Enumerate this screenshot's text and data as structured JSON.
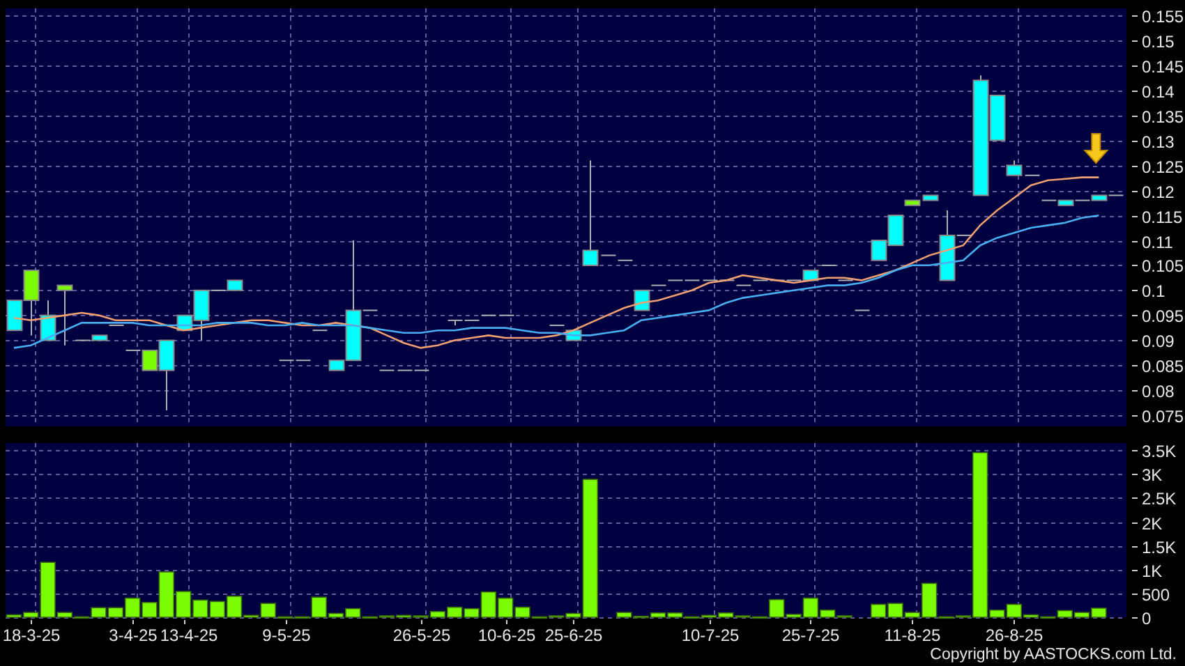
{
  "price_panel": {
    "chart_data": {
      "type": "candlestick",
      "grid": true,
      "categories": [
        null,
        null,
        null,
        null,
        null,
        null,
        null,
        null,
        null,
        null,
        null,
        null,
        null,
        null,
        null,
        null,
        null,
        null,
        null,
        null,
        null,
        null,
        null,
        null,
        null,
        null,
        null,
        null,
        null,
        null,
        null,
        null,
        null,
        null,
        null,
        null,
        null,
        null,
        null,
        null,
        null,
        null,
        null,
        null,
        null,
        null,
        null,
        null,
        null,
        null,
        null,
        null,
        null,
        null,
        null,
        null,
        null,
        null,
        null,
        null,
        null,
        null,
        null,
        null,
        null,
        null
      ],
      "yticks": [
        0.075,
        0.08,
        0.085,
        0.09,
        0.095,
        0.1,
        0.105,
        0.11,
        0.115,
        0.12,
        0.125,
        0.13,
        0.135,
        0.14,
        0.145,
        0.15,
        0.155
      ],
      "ylim": [
        0.0728,
        0.1564
      ],
      "ohlc": [
        [
          0.098,
          0.098,
          0.092,
          0.092
        ],
        [
          0.098,
          0.104,
          0.091,
          0.104
        ],
        [
          0.095,
          0.098,
          0.09,
          0.09
        ],
        [
          0.1,
          0.101,
          0.089,
          0.101
        ],
        [
          0.09,
          0.09,
          0.09,
          0.09
        ],
        [
          0.091,
          0.091,
          0.09,
          0.09
        ],
        [
          0.093,
          0.093,
          0.093,
          0.093
        ],
        [
          0.088,
          0.088,
          0.088,
          0.088
        ],
        [
          0.084,
          0.088,
          0.084,
          0.088
        ],
        [
          0.09,
          0.09,
          0.076,
          0.084
        ],
        [
          0.095,
          0.095,
          0.092,
          0.092
        ],
        [
          0.1,
          0.1,
          0.09,
          0.094
        ],
        [
          0.1,
          0.1,
          0.1,
          0.1
        ],
        [
          0.102,
          0.102,
          0.1,
          0.1
        ],
        null,
        null,
        [
          0.086,
          0.086,
          0.086,
          0.086
        ],
        [
          0.086,
          0.086,
          0.086,
          0.086
        ],
        [
          0.092,
          0.092,
          0.092,
          0.092
        ],
        [
          0.086,
          0.086,
          0.084,
          0.084
        ],
        [
          0.096,
          0.11,
          0.086,
          0.086
        ],
        [
          0.096,
          0.096,
          0.096,
          0.096
        ],
        [
          0.084,
          0.084,
          0.084,
          0.084
        ],
        [
          0.084,
          0.084,
          0.084,
          0.084
        ],
        [
          0.084,
          0.084,
          0.084,
          0.084
        ],
        null,
        [
          0.094,
          0.094,
          0.093,
          0.094
        ],
        [
          0.094,
          0.094,
          0.094,
          0.094
        ],
        [
          0.095,
          0.095,
          0.095,
          0.095
        ],
        [
          0.095,
          0.095,
          0.095,
          0.095
        ],
        null,
        null,
        [
          0.093,
          0.093,
          0.093,
          0.093
        ],
        [
          0.092,
          0.092,
          0.09,
          0.09
        ],
        [
          0.108,
          0.126,
          0.105,
          0.105
        ],
        [
          0.107,
          0.107,
          0.107,
          0.107
        ],
        [
          0.106,
          0.106,
          0.106,
          0.106
        ],
        [
          0.1,
          0.1,
          0.096,
          0.096
        ],
        [
          0.101,
          0.101,
          0.101,
          0.101
        ],
        [
          0.102,
          0.102,
          0.102,
          0.102
        ],
        [
          0.102,
          0.102,
          0.102,
          0.102
        ],
        [
          0.102,
          0.102,
          0.102,
          0.102
        ],
        [
          0.102,
          0.102,
          0.102,
          0.102
        ],
        [
          0.101,
          0.101,
          0.101,
          0.101
        ],
        [
          0.102,
          0.102,
          0.102,
          0.102
        ],
        [
          0.102,
          0.102,
          0.102,
          0.102
        ],
        [
          0.102,
          0.102,
          0.102,
          0.102
        ],
        [
          0.104,
          0.104,
          0.102,
          0.102
        ],
        [
          0.105,
          0.105,
          0.105,
          0.105
        ],
        [
          0.102,
          0.102,
          0.102,
          0.102
        ],
        [
          0.096,
          0.096,
          0.096,
          0.096
        ],
        [
          0.11,
          0.11,
          0.106,
          0.106
        ],
        [
          0.115,
          0.115,
          0.109,
          0.109
        ],
        [
          0.117,
          0.118,
          0.117,
          0.118
        ],
        [
          0.119,
          0.119,
          0.118,
          0.118
        ],
        [
          0.111,
          0.116,
          0.102,
          0.102
        ],
        [
          0.111,
          0.111,
          0.111,
          0.111
        ],
        [
          0.142,
          0.143,
          0.119,
          0.119
        ],
        [
          0.139,
          0.139,
          0.13,
          0.13
        ],
        [
          0.125,
          0.126,
          0.123,
          0.123
        ],
        [
          0.123,
          0.123,
          0.123,
          0.123
        ],
        [
          0.118,
          0.118,
          0.118,
          0.118
        ],
        [
          0.118,
          0.118,
          0.117,
          0.117
        ],
        [
          0.118,
          0.118,
          0.118,
          0.118
        ],
        [
          0.119,
          0.119,
          0.118,
          0.118
        ],
        [
          0.119,
          0.119,
          0.119,
          0.119
        ]
      ],
      "series": [
        {
          "type": "line",
          "color": "#f0a070",
          "values": [
            0.0945,
            0.094,
            0.0945,
            0.095,
            0.0955,
            0.095,
            0.094,
            0.094,
            0.094,
            0.093,
            0.092,
            0.0925,
            0.093,
            0.0935,
            0.094,
            0.094,
            0.0935,
            0.093,
            0.093,
            0.0935,
            0.093,
            0.0925,
            0.091,
            0.0895,
            0.0885,
            0.089,
            0.09,
            0.0905,
            0.091,
            0.0905,
            0.0905,
            0.0905,
            0.091,
            0.092,
            0.0935,
            0.095,
            0.0965,
            0.0975,
            0.098,
            0.099,
            0.1,
            0.1015,
            0.102,
            0.103,
            0.1025,
            0.102,
            0.1015,
            0.102,
            0.1025,
            0.1025,
            0.102,
            0.103,
            0.104,
            0.1055,
            0.107,
            0.108,
            0.109,
            0.113,
            0.116,
            0.1185,
            0.121,
            0.122,
            0.1223,
            0.1226,
            0.1226,
            null
          ]
        },
        {
          "type": "line",
          "color": "#48aef0",
          "values": [
            0.0885,
            0.089,
            0.0905,
            0.092,
            0.0935,
            0.0935,
            0.0935,
            0.0935,
            0.093,
            0.093,
            0.093,
            0.093,
            0.0935,
            0.0935,
            0.0935,
            0.093,
            0.093,
            0.0935,
            0.093,
            0.093,
            0.093,
            0.0925,
            0.092,
            0.0915,
            0.0915,
            0.092,
            0.092,
            0.0925,
            0.0925,
            0.0925,
            0.092,
            0.0915,
            0.0915,
            0.091,
            0.091,
            0.0915,
            0.092,
            0.094,
            0.0945,
            0.095,
            0.0955,
            0.096,
            0.0975,
            0.0985,
            0.099,
            0.0995,
            0.1,
            0.1005,
            0.101,
            0.101,
            0.1015,
            0.1025,
            0.104,
            0.105,
            0.105,
            0.1055,
            0.106,
            0.109,
            0.1105,
            0.1115,
            0.1125,
            0.113,
            0.1135,
            0.1145,
            0.115,
            null
          ]
        }
      ]
    }
  },
  "volume_panel": {
    "chart_data": {
      "type": "bar",
      "grid": true,
      "categories": [
        null,
        "18-3-25",
        null,
        null,
        null,
        null,
        null,
        "3-4-25",
        null,
        null,
        "13-4-25",
        null,
        null,
        null,
        null,
        null,
        "9-5-25",
        null,
        null,
        null,
        null,
        null,
        null,
        null,
        "26-5-25",
        null,
        null,
        null,
        null,
        "10-6-25",
        null,
        null,
        null,
        "25-6-25",
        null,
        null,
        null,
        null,
        null,
        null,
        null,
        "10-7-25",
        null,
        null,
        null,
        null,
        null,
        "25-7-25",
        null,
        null,
        null,
        null,
        null,
        "11-8-25",
        null,
        null,
        null,
        null,
        null,
        "26-8-25",
        null,
        null,
        null,
        null,
        null,
        null
      ],
      "ylim": [
        0,
        3650
      ],
      "yticks": [
        {
          "value": 0,
          "label": "0"
        },
        {
          "value": 500,
          "label": "500"
        },
        {
          "value": 1000,
          "label": "1K"
        },
        {
          "value": 1500,
          "label": "1.5K"
        },
        {
          "value": 2000,
          "label": "2K"
        },
        {
          "value": 2500,
          "label": "2.5K"
        },
        {
          "value": 3000,
          "label": "3K"
        },
        {
          "value": 3500,
          "label": "3.5K"
        }
      ],
      "series": [
        {
          "color": "#7cfc00",
          "values": [
            50,
            100,
            1150,
            100,
            10,
            200,
            200,
            400,
            310,
            950,
            540,
            360,
            330,
            440,
            40,
            290,
            10,
            10,
            420,
            80,
            180,
            10,
            30,
            40,
            30,
            120,
            210,
            180,
            530,
            400,
            210,
            10,
            30,
            80,
            2890,
            0,
            100,
            20,
            90,
            90,
            10,
            40,
            90,
            30,
            10,
            370,
            60,
            400,
            150,
            30,
            0,
            270,
            290,
            100,
            710,
            10,
            30,
            3450,
            150,
            270,
            50,
            10,
            140,
            100,
            190,
            0
          ]
        }
      ]
    }
  },
  "copyright": "Copyright by AASTOCKS.com Ltd."
}
